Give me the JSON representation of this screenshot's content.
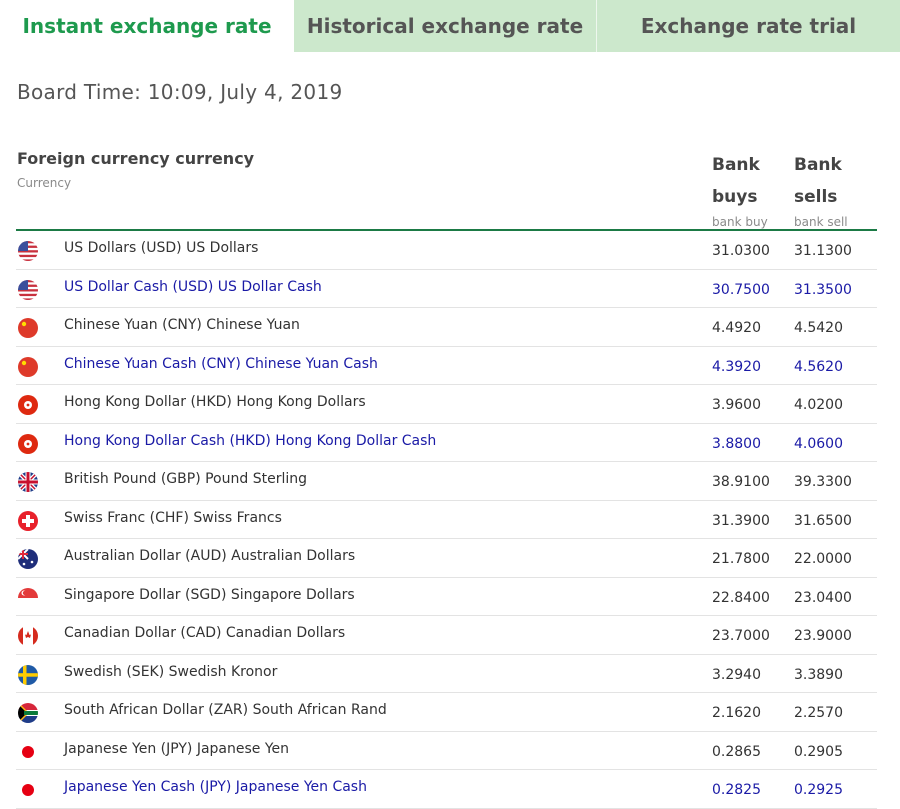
{
  "tabs": [
    {
      "label": "Instant exchange rate"
    },
    {
      "label": "Historical exchange rate"
    },
    {
      "label": "Exchange rate trial"
    }
  ],
  "board_time": "Board Time: 10:09, July 4, 2019",
  "table": {
    "currency_header": "Foreign currency currency",
    "currency_subheader": "Currency",
    "buy_header": "Bank buys",
    "buy_subheader": "bank buy",
    "sell_header": "Bank sells",
    "sell_subheader": "bank sell",
    "rows": [
      {
        "name": "US Dollars (USD) US Dollars",
        "buy": "31.0300",
        "sell": "31.1300",
        "flag": "us-flag-icon",
        "link": false
      },
      {
        "name": "US Dollar Cash (USD) US Dollar Cash",
        "buy": "30.7500",
        "sell": "31.3500",
        "flag": "us-flag-icon",
        "link": true
      },
      {
        "name": "Chinese Yuan (CNY) Chinese Yuan",
        "buy": "4.4920",
        "sell": "4.5420",
        "flag": "cn-flag-icon",
        "link": false
      },
      {
        "name": "Chinese Yuan Cash (CNY) Chinese Yuan Cash",
        "buy": "4.3920",
        "sell": "4.5620",
        "flag": "cn-flag-icon",
        "link": true
      },
      {
        "name": "Hong Kong Dollar (HKD) Hong Kong Dollars",
        "buy": "3.9600",
        "sell": "4.0200",
        "flag": "hk-flag-icon",
        "link": false
      },
      {
        "name": "Hong Kong Dollar Cash (HKD) Hong Kong Dollar Cash",
        "buy": "3.8800",
        "sell": "4.0600",
        "flag": "hk-flag-icon",
        "link": true
      },
      {
        "name": "British Pound (GBP) Pound Sterling",
        "buy": "38.9100",
        "sell": "39.3300",
        "flag": "gb-flag-icon",
        "link": false
      },
      {
        "name": "Swiss Franc (CHF) Swiss Francs",
        "buy": "31.3900",
        "sell": "31.6500",
        "flag": "ch-flag-icon",
        "link": false
      },
      {
        "name": "Australian Dollar (AUD) Australian Dollars",
        "buy": "21.7800",
        "sell": "22.0000",
        "flag": "au-flag-icon",
        "link": false
      },
      {
        "name": "Singapore Dollar (SGD) Singapore Dollars",
        "buy": "22.8400",
        "sell": "23.0400",
        "flag": "sg-flag-icon",
        "link": false
      },
      {
        "name": "Canadian Dollar (CAD) Canadian Dollars",
        "buy": "23.7000",
        "sell": "23.9000",
        "flag": "ca-flag-icon",
        "link": false
      },
      {
        "name": "Swedish (SEK) Swedish Kronor",
        "buy": "3.2940",
        "sell": "3.3890",
        "flag": "se-flag-icon",
        "link": false
      },
      {
        "name": "South African Dollar (ZAR) South African Rand",
        "buy": "2.1620",
        "sell": "2.2570",
        "flag": "za-flag-icon",
        "link": false
      },
      {
        "name": "Japanese Yen (JPY) Japanese Yen",
        "buy": "0.2865",
        "sell": "0.2905",
        "flag": "jp-flag-icon",
        "link": false
      },
      {
        "name": "Japanese Yen Cash (JPY) Japanese Yen Cash",
        "buy": "0.2825",
        "sell": "0.2925",
        "flag": "jp-flag-icon",
        "link": true
      }
    ]
  },
  "colors": {
    "active_tab_text": "#1e9a4e",
    "inactive_tab_bg": "#cce8cc",
    "header_rule": "#1b7a45",
    "link_text": "#1a1aa6"
  }
}
